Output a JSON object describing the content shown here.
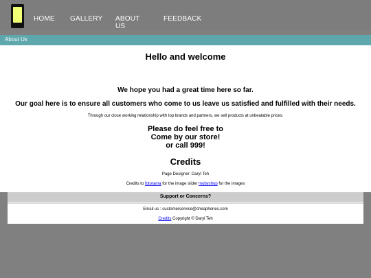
{
  "nav": {
    "items": [
      {
        "label": "HOME"
      },
      {
        "label": "GALLERY"
      },
      {
        "label": "ABOUT US"
      },
      {
        "label": "FEEDBACK"
      }
    ]
  },
  "subheader": {
    "label": "About Us"
  },
  "main": {
    "heading": "Hello and welcome",
    "line1": "We hope you had a great time here so far.",
    "line2": "Our goal here is to ensure all customers who come to us leave us satisfied and fulfilled with their needs.",
    "line3": "Through our close working relationship with top brands and partners, we sell products at unbeatable prices.",
    "promo": [
      "Please do feel free to",
      "Come by our store!",
      "or call 999!"
    ]
  },
  "credits": {
    "heading": "Credits",
    "designer": "Page Designer: Daryl Teh",
    "credits_prefix": "Credits to ",
    "link1": "fotorama",
    "middle": " for the image slider ",
    "link2": "mobyshop",
    "suffix": " for the images"
  },
  "footer": {
    "support": "Support or Concerns?",
    "email": "Email us : customerservice@cheaphones.com",
    "credits_link": "Credits",
    "copyright": " Copyright © Daryl Teh"
  },
  "colors": {
    "page_bg": "#808080",
    "header_bg": "#7d7d7d",
    "subbar_bg": "#5ea8ad",
    "logo_screen": "#f1ff74",
    "link": "#0000ee"
  },
  "icons": {
    "logo": "phone-icon"
  }
}
